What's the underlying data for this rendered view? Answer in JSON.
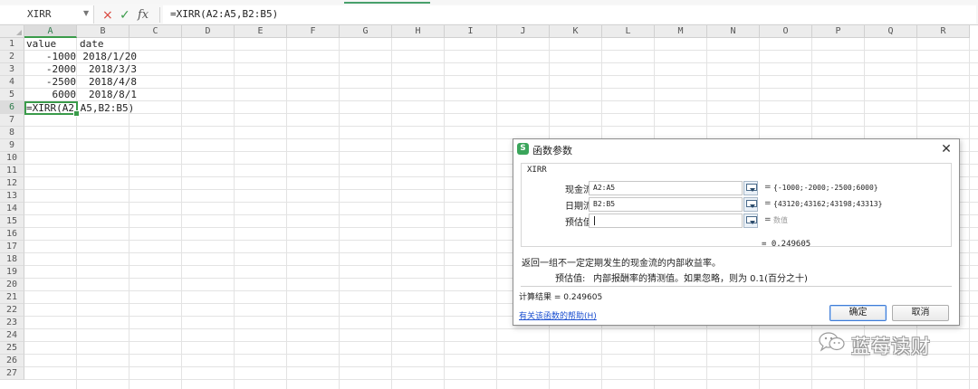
{
  "formula_bar": {
    "name_box": "XIRR",
    "cancel_icon": "×",
    "confirm_icon": "✓",
    "fx_label": "fx",
    "formula": "=XIRR(A2:A5,B2:B5)"
  },
  "sheet": {
    "columns": [
      "A",
      "B",
      "C",
      "D",
      "E",
      "F",
      "G",
      "H",
      "I",
      "J",
      "K",
      "L",
      "M",
      "N",
      "O",
      "P",
      "Q",
      "R"
    ],
    "rows": [
      "1",
      "2",
      "3",
      "4",
      "5",
      "6",
      "7",
      "8",
      "9",
      "10",
      "11",
      "12",
      "13",
      "14",
      "15",
      "16",
      "17",
      "18",
      "19",
      "20",
      "21",
      "22",
      "23",
      "24",
      "25",
      "26",
      "27"
    ],
    "selected_column": "A",
    "selected_row": "6",
    "cells": {
      "A1": "value",
      "B1": "date",
      "A2": "-1000",
      "B2": "2018/1/20",
      "A3": "-2000",
      "B3": "2018/3/3",
      "A4": "-2500",
      "B4": "2018/4/8",
      "A5": "6000",
      "B5": "2018/8/1",
      "A6": "=XIRR(A2:A5,B2:B5)"
    }
  },
  "dialog": {
    "logo": "S",
    "title": "函数参数",
    "close_icon": "✕",
    "function_name": "XIRR",
    "args": [
      {
        "label": "现金流",
        "value": "A2:A5",
        "result": "{-1000;-2000;-2500;6000}"
      },
      {
        "label": "日期流",
        "value": "B2:B5",
        "result": "{43120;43162;43198;43313}"
      },
      {
        "label": "预估值",
        "value": "",
        "result": "数值"
      }
    ],
    "equals": "=",
    "total": "= 0.249605",
    "description": "返回一组不一定定期发生的现金流的内部收益率。",
    "arg_desc_name": "预估值:",
    "arg_desc_text": "内部报酬率的猜测值。如果忽略，则为 0.1(百分之十)",
    "result_line": "计算结果 = 0.249605",
    "help_link": "有关该函数的帮助(H)",
    "ok_label": "确定",
    "cancel_label": "取消"
  },
  "watermark": {
    "text": "蓝莓读财",
    "icon": "wechat-icon"
  },
  "colors": {
    "accent_green": "#3a9b4a",
    "link_blue": "#1b4fd0",
    "cancel_red": "#d9443b"
  }
}
